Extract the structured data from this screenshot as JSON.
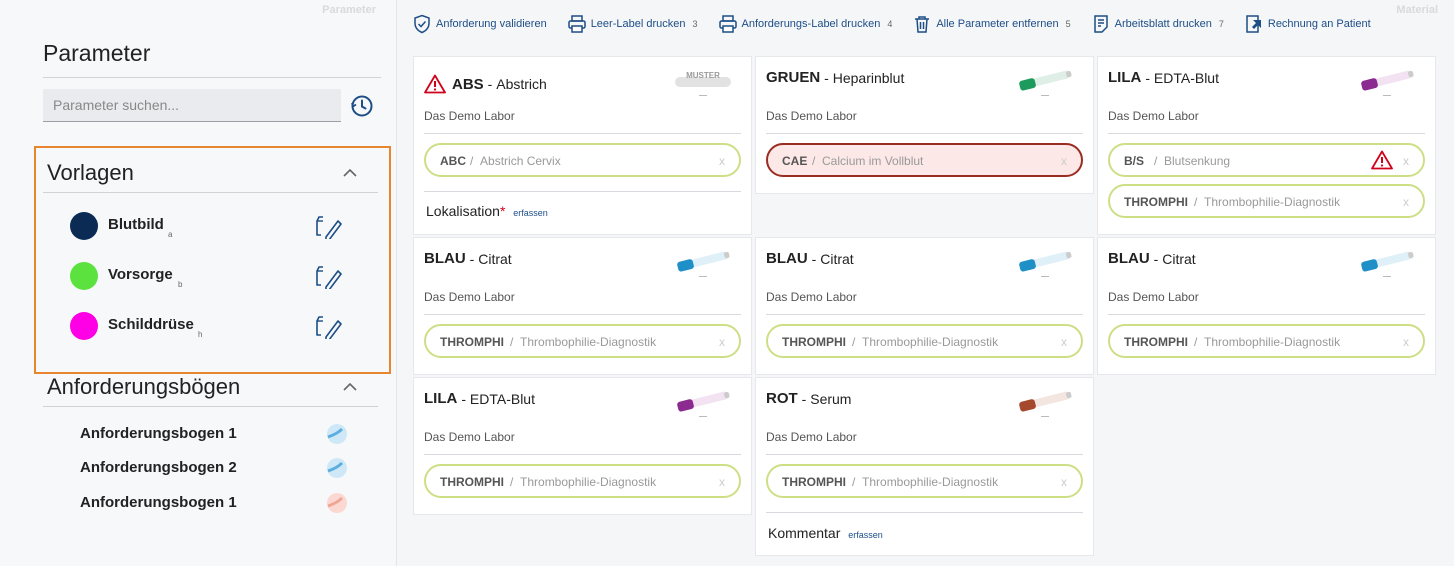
{
  "sidebar": {
    "section_label": "Parameter",
    "title": "Parameter",
    "search_placeholder": "Parameter suchen...",
    "vorlagen": {
      "title": "Vorlagen",
      "items": [
        {
          "name": "Blutbild",
          "key": "a",
          "color": "#0b2b55"
        },
        {
          "name": "Vorsorge",
          "key": "b",
          "color": "#5ce23f"
        },
        {
          "name": "Schilddrüse",
          "key": "h",
          "color": "#ff00e6"
        }
      ]
    },
    "boegen": {
      "title": "Anforderungsbögen",
      "items": [
        {
          "name": "Anforderungsbogen 1",
          "icon": "blue-gauge-icon"
        },
        {
          "name": "Anforderungsbogen 2",
          "icon": "blue-gauge-icon"
        },
        {
          "name": "Anforderungsbogen 1",
          "icon": "red-gauge-icon"
        }
      ]
    }
  },
  "main": {
    "section_label": "Material",
    "toolbar": [
      {
        "label": "Anforderung validieren",
        "count": "",
        "icon": "shield-check-icon"
      },
      {
        "label": "Leer-Label drucken",
        "count": "3",
        "icon": "printer-icon"
      },
      {
        "label": "Anforderungs-Label drucken",
        "count": "4",
        "icon": "printer-icon"
      },
      {
        "label": "Alle Parameter entfernen",
        "count": "5",
        "icon": "trash-icon"
      },
      {
        "label": "Arbeitsblatt drucken",
        "count": "7",
        "icon": "document-icon"
      },
      {
        "label": "Rechnung an Patient",
        "count": "",
        "icon": "invoice-icon"
      }
    ],
    "cards": [
      {
        "code": "ABS",
        "material": "Abstrich",
        "lab": "Das Demo Labor",
        "tube": "muster",
        "warn": true,
        "chips": [
          {
            "code": "ABC",
            "desc": "Abstrich Cervix",
            "x": "x"
          }
        ],
        "extra": {
          "label": "Lokalisation",
          "required": "*",
          "action": "erfassen"
        }
      },
      {
        "code": "GRUEN",
        "material": "Heparinblut",
        "lab": "Das Demo Labor",
        "tube": "#1e9a5c",
        "chips": [
          {
            "code": "CAE",
            "desc": "Calcium im Vollblut",
            "x": "x",
            "error": true
          }
        ]
      },
      {
        "code": "LILA",
        "material": "EDTA-Blut",
        "lab": "Das Demo Labor",
        "tube": "#8b2a8f",
        "chips": [
          {
            "code": "B/S",
            "desc": "Blutsenkung",
            "x": "x",
            "warn": true
          },
          {
            "code": "THROMPHI",
            "desc": "Thrombophilie-Diagnostik",
            "x": "x"
          }
        ]
      },
      {
        "code": "BLAU",
        "material": "Citrat",
        "lab": "Das Demo Labor",
        "tube": "#1f8fc7",
        "chips": [
          {
            "code": "THROMPHI",
            "desc": "Thrombophilie-Diagnostik",
            "x": "x"
          }
        ]
      },
      {
        "code": "BLAU",
        "material": "Citrat",
        "lab": "Das Demo Labor",
        "tube": "#1f8fc7",
        "chips": [
          {
            "code": "THROMPHI",
            "desc": "Thrombophilie-Diagnostik",
            "x": "x"
          }
        ]
      },
      {
        "code": "BLAU",
        "material": "Citrat",
        "lab": "Das Demo Labor",
        "tube": "#1f8fc7",
        "chips": [
          {
            "code": "THROMPHI",
            "desc": "Thrombophilie-Diagnostik",
            "x": "x"
          }
        ]
      },
      {
        "code": "LILA",
        "material": "EDTA-Blut",
        "lab": "Das Demo Labor",
        "tube": "#8b2a8f",
        "chips": [
          {
            "code": "THROMPHI",
            "desc": "Thrombophilie-Diagnostik",
            "x": "x"
          }
        ]
      },
      {
        "code": "ROT",
        "material": "Serum",
        "lab": "Das Demo Labor",
        "tube": "#a4492e",
        "chips": [
          {
            "code": "THROMPHI",
            "desc": "Thrombophilie-Diagnostik",
            "x": "x"
          }
        ],
        "extra": {
          "label": "Kommentar",
          "required": "",
          "action": "erfassen"
        }
      }
    ],
    "muster_text": "MUSTER"
  }
}
